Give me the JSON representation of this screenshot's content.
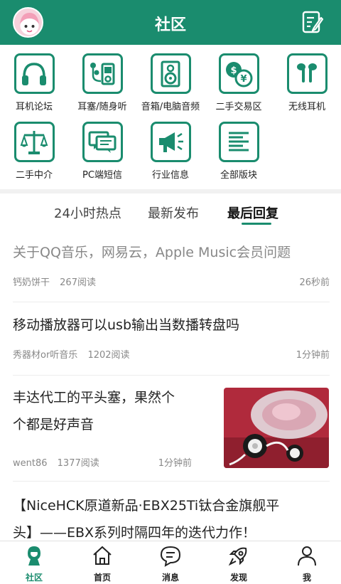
{
  "header": {
    "title": "社区"
  },
  "categories": [
    {
      "label": "耳机论坛",
      "icon": "headphones-icon"
    },
    {
      "label": "耳塞/随身听",
      "icon": "earbuds-player-icon"
    },
    {
      "label": "音箱/电脑音频",
      "icon": "speaker-icon"
    },
    {
      "label": "二手交易区",
      "icon": "trade-icon"
    },
    {
      "label": "无线耳机",
      "icon": "wireless-earbuds-icon"
    },
    {
      "label": "二手中介",
      "icon": "scale-icon"
    },
    {
      "label": "PC端短信",
      "icon": "messages-icon"
    },
    {
      "label": "行业信息",
      "icon": "megaphone-icon"
    },
    {
      "label": "全部版块",
      "icon": "list-icon"
    }
  ],
  "tabs": [
    {
      "label": "24小时热点",
      "active": false
    },
    {
      "label": "最新发布",
      "active": false
    },
    {
      "label": "最后回复",
      "active": true
    }
  ],
  "posts": [
    {
      "title": "关于QQ音乐，网易云，Apple Music会员问题",
      "author": "钙奶饼干",
      "reads": "267阅读",
      "time": "26秒前"
    },
    {
      "title": "移动播放器可以usb输出当数播转盘吗",
      "author": "秀器材or听音乐",
      "reads": "1202阅读",
      "time": "1分钟前"
    },
    {
      "title_line1": "丰达代工的平头塞，果然个",
      "title_line2": "个都是好声音",
      "author": "went86",
      "reads": "1377阅读",
      "time": "1分钟前"
    },
    {
      "title_line1": "【NiceHCK原道新品·EBX25Ti钛合金旗舰平",
      "title_line2": "头】——EBX系列时隔四年的迭代力作！"
    }
  ],
  "bottom_nav": [
    {
      "label": "社区",
      "active": true
    },
    {
      "label": "首页",
      "active": false
    },
    {
      "label": "消息",
      "active": false
    },
    {
      "label": "发现",
      "active": false
    },
    {
      "label": "我",
      "active": false
    }
  ],
  "colors": {
    "brand": "#1a8c6e"
  }
}
